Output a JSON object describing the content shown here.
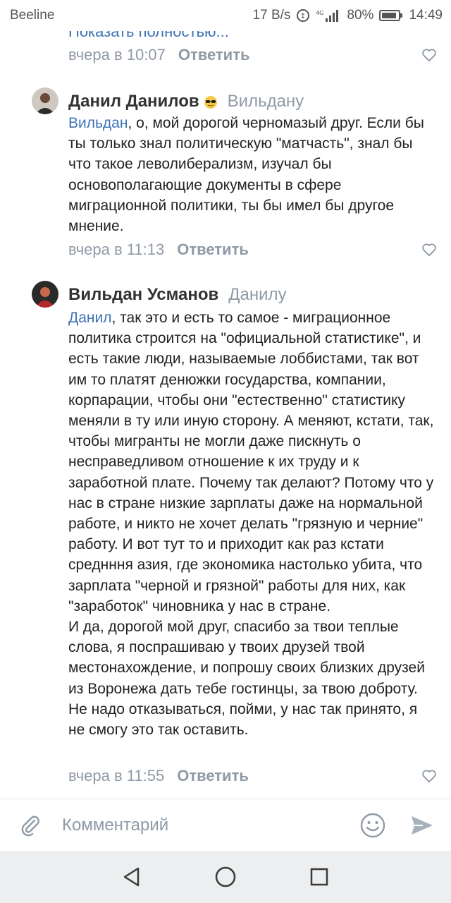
{
  "status_bar": {
    "carrier": "Beeline",
    "speed": "17 B/s",
    "battery": "80%",
    "time": "14:49"
  },
  "thread": {
    "truncated_link": "Показать полностью...",
    "prev_time": "вчера в 10:07",
    "reply_label": "Ответить",
    "comments": [
      {
        "author": "Данил Данилов",
        "reply_to": "Вильдану",
        "mention": "Вильдан",
        "text": ", о, мой дорогой черномазый друг. Если бы ты только знал политическую \"матчасть\", знал бы что такое леволиберализм, изучал бы основополагающие документы в сфере миграционной политики, ты бы имел бы другое мнение.",
        "time": "вчера в 11:13"
      },
      {
        "author": "Вильдан Усманов",
        "reply_to": "Данилу",
        "mention": "Данил",
        "text": ", так это и есть то самое - миграционное политика строится на \"официальной статистике\", и есть такие люди, называемые лоббистами, так вот им то платят денюжки государства, компании, корпарации, чтобы они \"естественно\" статистику меняли в ту или иную сторону. А меняют, кстати, так, чтобы мигранты не могли даже пискнуть о несправедливом отношение к их труду и к заработной плате. Почему так делают? Потому что у нас в стране низкие зарплаты даже на нормальной работе, и никто не хочет делать \"грязную и черние\" работу. И вот тут то и приходит как раз кстати среднння азия, где экономика настолько убита, что зарплата \"черной и грязной\" работы для них, как \"заработок\" чиновника у нас в стране.",
        "text2": "И да, дорогой мой друг, спасибо за твои теплые слова, я поспрашиваю у твоих друзей твой местонахождение, и попрошу своих близких друзей из Воронежа дать тебе гостинцы, за твою доброту. Не надо отказываться, пойми, у нас так принято, я не смогу это так оставить.",
        "time": "вчера в 11:55"
      }
    ]
  },
  "comment_bar": {
    "placeholder": "Комментарий"
  },
  "colors": {
    "link": "#3d73b4",
    "meta": "#8f9aa6",
    "nav_bg": "#eceeef"
  },
  "icons": [
    "paperclip-icon",
    "smile-icon",
    "send-icon",
    "heart-icon",
    "back-icon",
    "home-icon",
    "recents-icon"
  ]
}
